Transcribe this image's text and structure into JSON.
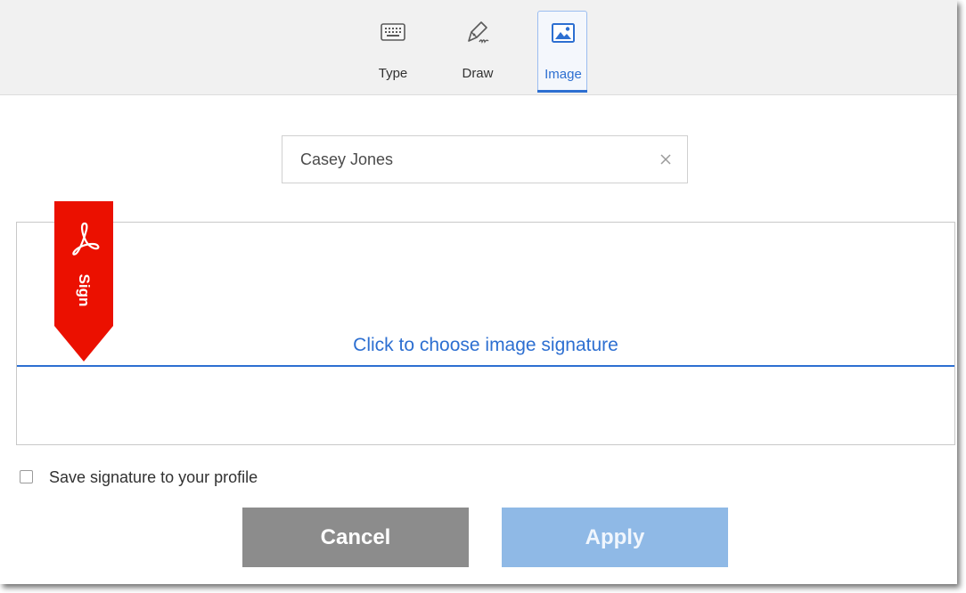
{
  "tabs": [
    {
      "label": "Type",
      "icon": "keyboard-icon",
      "active": false
    },
    {
      "label": "Draw",
      "icon": "pen-icon",
      "active": false
    },
    {
      "label": "Image",
      "icon": "image-icon",
      "active": true
    }
  ],
  "name_field": {
    "value": "Casey Jones",
    "clear_icon": "close-icon"
  },
  "signature_area": {
    "prompt": "Click to choose image signature"
  },
  "ribbon": {
    "label": "Sign",
    "icon": "acrobat-logo-icon",
    "color": "#eb1000"
  },
  "save_option": {
    "label": "Save signature to your profile",
    "checked": false
  },
  "buttons": {
    "cancel": "Cancel",
    "apply": "Apply"
  },
  "colors": {
    "accent": "#2d6fd1",
    "cancel_bg": "#8c8c8c",
    "apply_bg": "#8fb9e6"
  }
}
